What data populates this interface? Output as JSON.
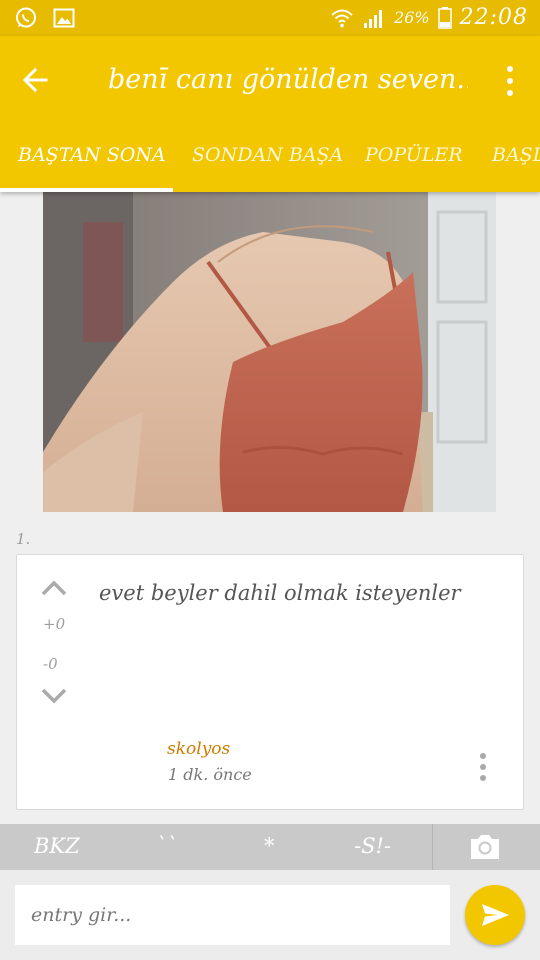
{
  "status_bar": {
    "battery": "26%",
    "time": "22:08"
  },
  "app_bar": {
    "title": "benī canı gönülden seven...",
    "tabs": [
      {
        "label": "BAŞTAN SONA",
        "active": true
      },
      {
        "label": "SONDAN BAŞA",
        "active": false
      },
      {
        "label": "POPÜLER",
        "active": false
      },
      {
        "label": "BAŞL",
        "active": false
      }
    ]
  },
  "entry": {
    "index": "1.",
    "text": "evet beyler dahil olmak isteyenler",
    "vote_plus": "+0",
    "vote_minus": "-0",
    "author": "skolyos",
    "time": "1 dk. önce"
  },
  "format_bar": {
    "bkz": "BKZ",
    "quote": "``",
    "star": "*",
    "spoiler": "-S!-"
  },
  "composer": {
    "placeholder": "entry gir..."
  },
  "colors": {
    "accent": "#f2c700",
    "status_bar": "#e6bb00",
    "author": "#d17a00"
  }
}
